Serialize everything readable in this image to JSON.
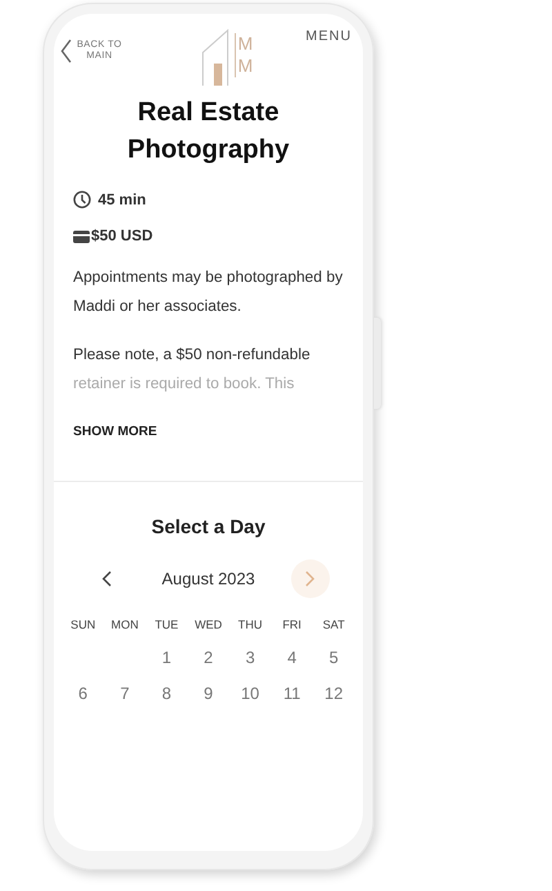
{
  "header": {
    "back_label": "BACK TO MAIN",
    "logo_letters": [
      "M",
      "M"
    ],
    "menu_label": "MENU"
  },
  "service": {
    "title": "Real Estate Photography",
    "duration": "45 min",
    "price": "$50 USD",
    "paragraphs": [
      {
        "text": "Appointments may be photographed by Maddi or her associates.",
        "kind": "full"
      },
      {
        "text": "Please note, a $50 non-refundable",
        "kind": "full"
      },
      {
        "text": "retainer is required to book. This",
        "kind": "faded"
      }
    ],
    "show_more": "SHOW MORE"
  },
  "calendar": {
    "title": "Select a Day",
    "month": "August 2023",
    "weekdays": [
      "SUN",
      "MON",
      "TUE",
      "WED",
      "THU",
      "FRI",
      "SAT"
    ],
    "weeks": [
      {
        "kind": "partial",
        "days": [
          "1",
          "2",
          "3",
          "4",
          "5"
        ]
      },
      {
        "kind": "full",
        "days": [
          "6",
          "7",
          "8",
          "9",
          "10",
          "11",
          "12"
        ]
      }
    ]
  }
}
